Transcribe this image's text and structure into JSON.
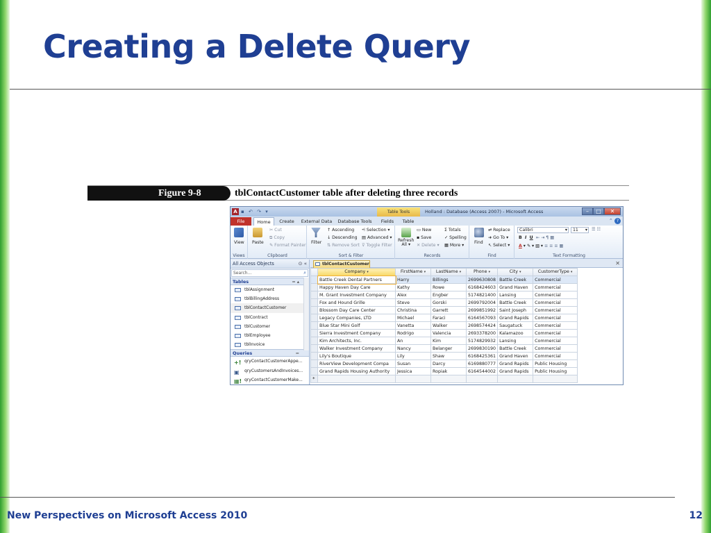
{
  "slide": {
    "title": "Creating a Delete Query",
    "footer": "New Perspectives on Microsoft Access 2010",
    "page_number": "12"
  },
  "figure": {
    "label": "Figure 9-8",
    "caption": "tblContactCustomer table after deleting three records"
  },
  "window": {
    "title": "Holland : Database (Access 2007) - Microsoft Access",
    "context_tab": "Table Tools",
    "file_tab": "File",
    "tabs": [
      "Home",
      "Create",
      "External Data",
      "Database Tools",
      "Fields",
      "Table"
    ]
  },
  "ribbon": {
    "views": {
      "view": "View",
      "label": "Views"
    },
    "clipboard": {
      "paste": "Paste",
      "cut": "Cut",
      "copy": "Copy",
      "format_painter": "Format Painter",
      "label": "Clipboard"
    },
    "sort_filter": {
      "filter": "Filter",
      "ascending": "Ascending",
      "descending": "Descending",
      "remove_sort": "Remove Sort",
      "selection": "Selection",
      "advanced": "Advanced",
      "toggle_filter": "Toggle Filter",
      "label": "Sort & Filter"
    },
    "records": {
      "refresh": "Refresh",
      "refresh_all": "All",
      "new": "New",
      "save": "Save",
      "delete": "Delete",
      "totals": "Totals",
      "spelling": "Spelling",
      "more": "More",
      "label": "Records"
    },
    "find": {
      "find": "Find",
      "replace": "Replace",
      "goto": "Go To",
      "select": "Select",
      "label": "Find"
    },
    "text_formatting": {
      "font": "Calibri",
      "size": "11",
      "label": "Text Formatting"
    }
  },
  "nav": {
    "header": "All Access Objects",
    "search_placeholder": "Search...",
    "tables_label": "Tables",
    "tables": [
      "tblAssignment",
      "tblBillingAddress",
      "tblContactCustomer",
      "tblContract",
      "tblCustomer",
      "tblEmployee",
      "tblInvoice"
    ],
    "queries_label": "Queries",
    "queries": [
      "qryContactCustomerAppe...",
      "qryCustomersAndInvoices...",
      "qryContactCustomerMake..."
    ]
  },
  "datasheet": {
    "tab": "tblContactCustomer",
    "columns": [
      "Company",
      "FirstName",
      "LastName",
      "Phone",
      "City",
      "CustomerType"
    ],
    "rows": [
      [
        "Battle Creek Dental Partners",
        "Harry",
        "Billings",
        "2699630808",
        "Battle Creek",
        "Commercial"
      ],
      [
        "Happy Haven Day Care",
        "Kathy",
        "Rowe",
        "6168424603",
        "Grand Haven",
        "Commercial"
      ],
      [
        "M. Grant Investment Company",
        "Alex",
        "Engber",
        "5174821400",
        "Lansing",
        "Commercial"
      ],
      [
        "Fox and Hound Grille",
        "Steve",
        "Gorski",
        "2699792004",
        "Battle Creek",
        "Commercial"
      ],
      [
        "Blossom Day Care Center",
        "Christina",
        "Garrett",
        "2699851992",
        "Saint Joseph",
        "Commercial"
      ],
      [
        "Legacy Companies, LTD",
        "Michael",
        "Faraci",
        "6164567093",
        "Grand Rapids",
        "Commercial"
      ],
      [
        "Blue Star Mini Golf",
        "Vanetta",
        "Walker",
        "2698574424",
        "Saugatuck",
        "Commercial"
      ],
      [
        "Sierra Investment Company",
        "Rodrigo",
        "Valencia",
        "2693378200",
        "Kalamazoo",
        "Commercial"
      ],
      [
        "Kim Architects, Inc.",
        "An",
        "Kim",
        "5174829932",
        "Lansing",
        "Commercial"
      ],
      [
        "Walker Investment Company",
        "Nancy",
        "Belanger",
        "2699830190",
        "Battle Creek",
        "Commercial"
      ],
      [
        "Lily's Boutique",
        "Lily",
        "Shaw",
        "6168425361",
        "Grand Haven",
        "Commercial"
      ],
      [
        "RiverView Development Compa",
        "Susan",
        "Darcy",
        "6169880777",
        "Grand Rapids",
        "Public Housing"
      ],
      [
        "Grand Rapids Housing Authority",
        "Jessica",
        "Ropiak",
        "6164544002",
        "Grand Rapids",
        "Public Housing"
      ]
    ],
    "new_row_marker": "*"
  },
  "colors": {
    "title": "#1f3f93",
    "accent_green": "#2f9e2f",
    "file_tab": "#c0322b"
  }
}
